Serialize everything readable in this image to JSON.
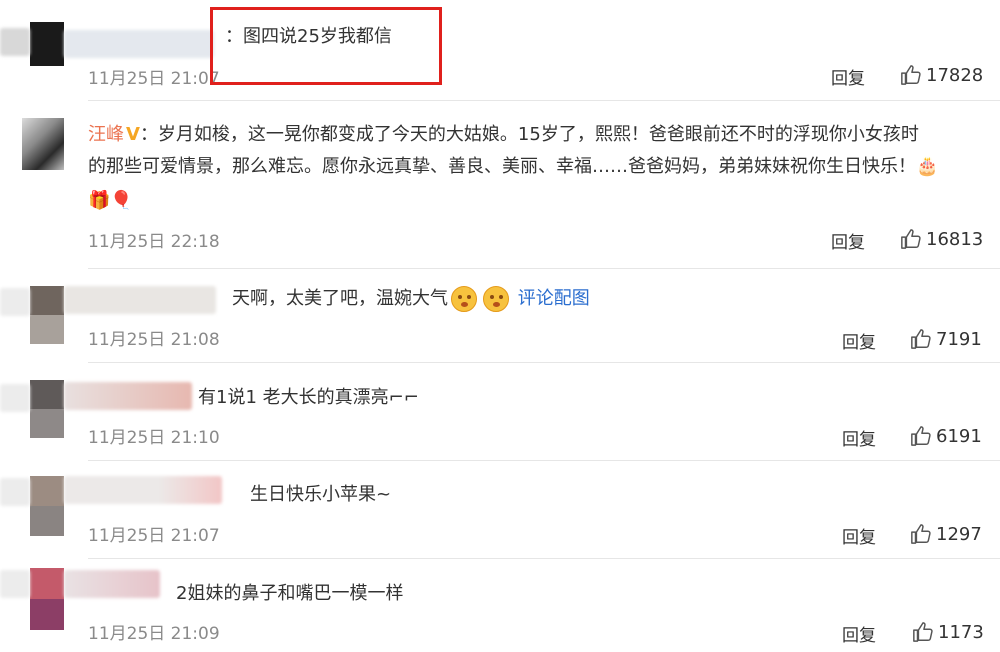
{
  "comments": [
    {
      "content": "：图四说25岁我都信",
      "time": "11月25日 21:07",
      "reply_label": "回复",
      "likes": "17828"
    },
    {
      "username": "汪峰",
      "verified_badge": "V",
      "content_line1": "：岁月如梭，这一晃你都变成了今天的大姑娘。15岁了，熙熙！爸爸眼前还不时的浮现你小女孩时",
      "content_line2": "的那些可爱情景，那么难忘。愿你永远真挚、善良、美丽、幸福……爸爸妈妈，弟弟妹妹祝你生日快乐！🎂",
      "content_line3": "🎁🎈",
      "time": "11月25日 22:18",
      "reply_label": "回复",
      "likes": "16813"
    },
    {
      "content": "天啊，太美了吧，温婉大气",
      "pic_link": "评论配图",
      "time": "11月25日 21:08",
      "reply_label": "回复",
      "likes": "7191"
    },
    {
      "content": "有1说1 老大长的真漂亮⌐⌐",
      "time": "11月25日 21:10",
      "reply_label": "回复",
      "likes": "6191"
    },
    {
      "content": "生日快乐小苹果~",
      "time": "11月25日 21:07",
      "reply_label": "回复",
      "likes": "1297"
    },
    {
      "content": "2姐妹的鼻子和嘴巴一模一样",
      "time": "11月25日 21:09",
      "reply_label": "回复",
      "likes": "1173"
    }
  ],
  "colors": {
    "highlight_box": "#e0201c",
    "username": "#eb7350",
    "link": "#2b6ecf",
    "timestamp": "#8a8a8a"
  }
}
